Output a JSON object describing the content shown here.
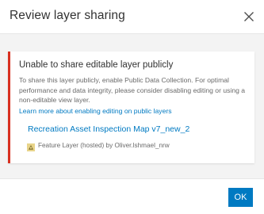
{
  "dialog": {
    "title": "Review layer sharing"
  },
  "notice": {
    "title": "Unable to share editable layer publicly",
    "body": "To share this layer publicly, enable Public Data Collection. For optimal performance and data integrity, please consider disabling editing or using a non-editable view layer.",
    "link": "Learn more about enabling editing on public layers",
    "accent_color": "#d83020"
  },
  "layer": {
    "name": "Recreation Asset Inspection Map v7_new_2",
    "meta": "Feature Layer (hosted) by Oliver.lshmael_nrw",
    "icon": "feature-layer-icon"
  },
  "footer": {
    "ok_label": "OK",
    "button_color": "#007ac2"
  }
}
